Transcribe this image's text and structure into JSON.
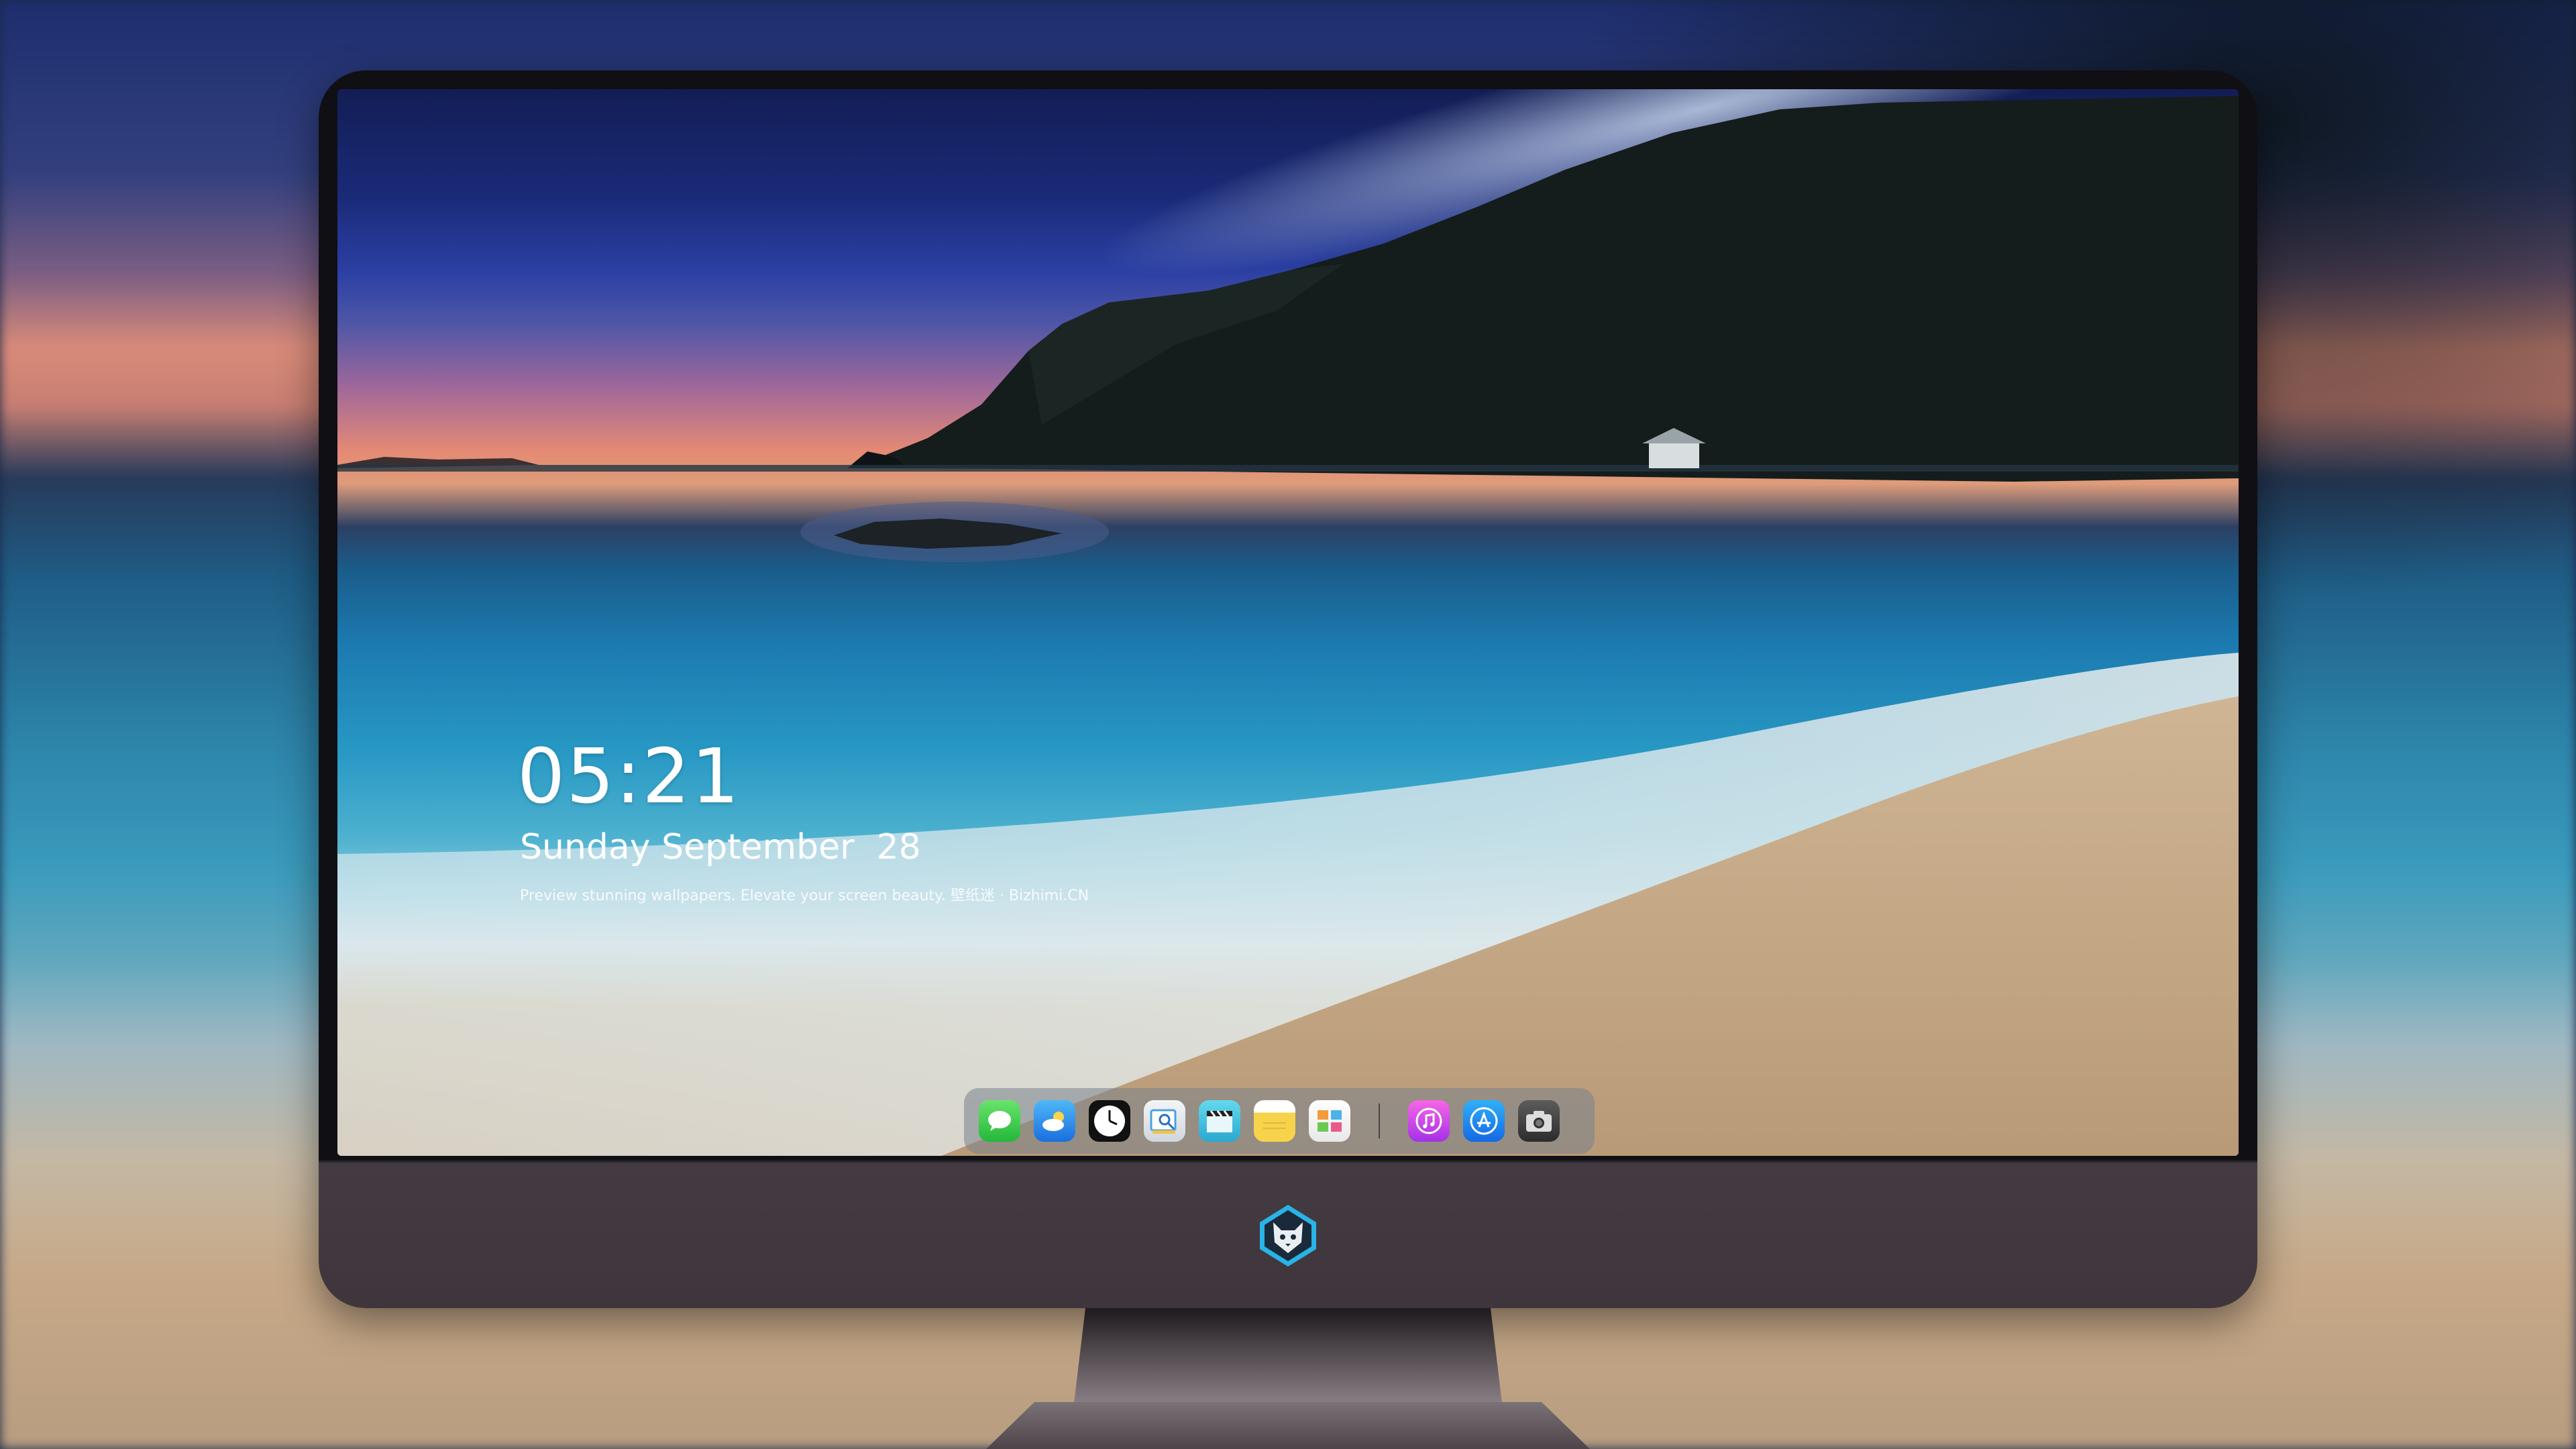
{
  "lock_screen": {
    "time": "05:21",
    "date": "Sunday September  28",
    "tagline": "Preview stunning wallpapers. Elevate your screen beauty. 壁纸迷 · Bizhimi.CN"
  },
  "dock": {
    "apps": [
      {
        "name": "messages-icon"
      },
      {
        "name": "weather-icon"
      },
      {
        "name": "clock-icon"
      },
      {
        "name": "preview-icon"
      },
      {
        "name": "clapperboard-icon"
      },
      {
        "name": "notes-icon"
      },
      {
        "name": "photos-icon"
      },
      {
        "name": "music-icon"
      },
      {
        "name": "app-store-icon"
      },
      {
        "name": "camera-icon"
      }
    ]
  },
  "monitor": {
    "chin_logo": "fox-mascot-logo"
  },
  "colors": {
    "sea": "#2798c4",
    "sand": "#c3a47f",
    "sky_top": "#1a2a78",
    "sunset": "#e58a74",
    "bezel": "#0f0f14",
    "chin": "#3e363c"
  }
}
